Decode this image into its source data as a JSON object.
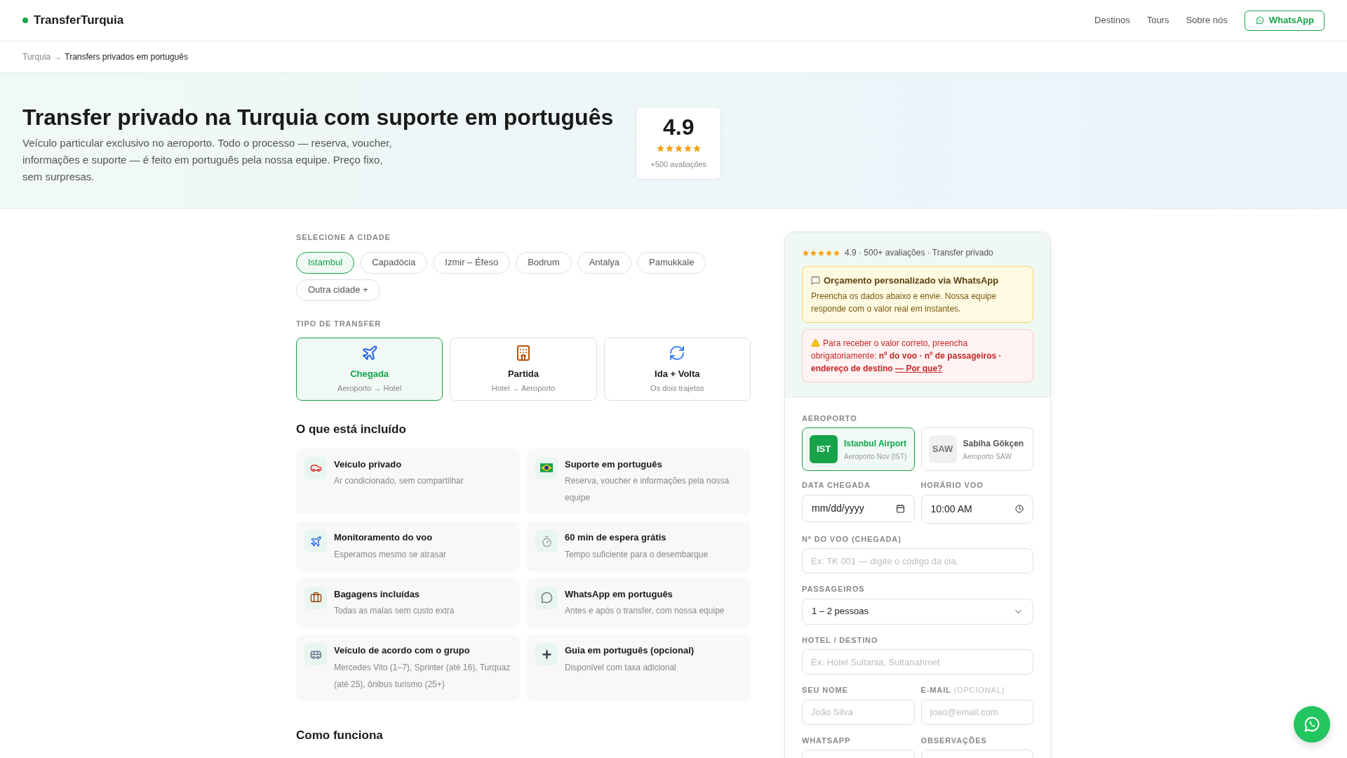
{
  "header": {
    "logo": "TransferTurquia",
    "nav": [
      "Destinos",
      "Tours",
      "Sobre nós"
    ],
    "whatsapp_button": "WhatsApp"
  },
  "breadcrumb": {
    "parent": "Turquia",
    "separator": "→",
    "current": "Transfers privados em português"
  },
  "hero": {
    "title": "Transfer privado na Turquia com suporte em português",
    "description": "Veículo particular exclusivo no aeroporto. Todo o processo — reserva, voucher, informações e suporte — é feito em português pela nossa equipe. Preço fixo, sem surpresas.",
    "rating": {
      "score": "4.9",
      "stars": 5,
      "count": "+500 avaliações"
    }
  },
  "city_section": {
    "label": "SELECIONE A CIDADE",
    "cities": [
      {
        "label": "Istambul",
        "selected": true
      },
      {
        "label": "Capadócia",
        "selected": false
      },
      {
        "label": "Izmir – Éfeso",
        "selected": false
      },
      {
        "label": "Bodrum",
        "selected": false
      },
      {
        "label": "Antalya",
        "selected": false
      },
      {
        "label": "Pamukkale",
        "selected": false
      },
      {
        "label": "Outra cidade +",
        "selected": false
      }
    ]
  },
  "transfer_section": {
    "label": "TIPO DE TRANSFER",
    "types": [
      {
        "kind": "plane",
        "title": "Chegada",
        "subtitle": "Aeroporto → Hotel",
        "selected": true
      },
      {
        "kind": "hotel",
        "title": "Partida",
        "subtitle": "Hotel → Aeroporto",
        "selected": false
      },
      {
        "kind": "roundtrip",
        "title": "Ida + Volta",
        "subtitle": "Os dois trajetos",
        "selected": false
      }
    ]
  },
  "included": {
    "title": "O que está incluído",
    "items": [
      {
        "kind": "car",
        "title": "Veículo privado",
        "text": "Ar condicionado, sem compartilhar"
      },
      {
        "kind": "flag",
        "title": "Suporte em português",
        "text": "Reserva, voucher e informações pela nossa equipe"
      },
      {
        "kind": "plane",
        "title": "Monitoramento do voo",
        "text": "Esperamos mesmo se atrasar"
      },
      {
        "kind": "timer",
        "title": "60 min de espera grátis",
        "text": "Tempo suficiente para o desembarque"
      },
      {
        "kind": "briefcase",
        "title": "Bagagens incluídas",
        "text": "Todas as malas sem custo extra"
      },
      {
        "kind": "chat",
        "title": "WhatsApp em português",
        "text": "Antes e após o transfer, com nossa equipe"
      },
      {
        "kind": "van",
        "title": "Veículo de acordo com o grupo",
        "text": "Mercedes Vito (1–7), Sprinter (até 16), Turquaz (até 25), ônibus turismo (25+)"
      },
      {
        "kind": "plus",
        "title": "Guia em português (opcional)",
        "text": "Disponível com taxa adicional"
      }
    ]
  },
  "how_it_works": {
    "title": "Como funciona"
  },
  "quote_card": {
    "rating_line": {
      "stars": 5,
      "text": "4.9 · 500+ avaliações · Transfer privado"
    },
    "info_box": {
      "title": "Orçamento personalizado via WhatsApp",
      "text": "Preencha os dados abaixo e envie. Nossa equipe responde com o valor real em instantes."
    },
    "warning_box": {
      "text": "Para receber o valor correto, preencha obrigatoriamente: **nº do voo · nº de passageiros · endereço de destino**",
      "link": "— Por que?"
    },
    "airport_label": "AEROPORTO",
    "airports": [
      {
        "code": "IST",
        "name": "Istanbul Airport",
        "sub": "Aeroporto Nov (IST)",
        "selected": true
      },
      {
        "code": "SAW",
        "name": "Sabiha Gökçen",
        "sub": "Aeroporto SAW",
        "selected": false
      }
    ],
    "date": {
      "label": "DATA CHEGADA",
      "value": "mm/dd/yyyy"
    },
    "time": {
      "label": "HORÁRIO VOO",
      "value": "10:00 AM"
    },
    "flight": {
      "label": "Nº DO VOO (CHEGADA)",
      "placeholder": "Ex: TK 001 — digite o código da cia."
    },
    "passengers": {
      "label": "PASSAGEIROS",
      "value": "1 – 2 pessoas"
    },
    "hotel": {
      "label": "HOTEL / DESTINO",
      "placeholder": "Ex: Hotel Sultania, Sultanahmet"
    },
    "name": {
      "label": "SEU NOME",
      "placeholder": "João Silva"
    },
    "email": {
      "label": "E-MAIL",
      "label_note": "(OPCIONAL)",
      "placeholder": "joao@email.com"
    },
    "whatsapp": {
      "label": "WHATSAPP"
    },
    "notes": {
      "label": "OBSERVAÇÕES"
    }
  }
}
